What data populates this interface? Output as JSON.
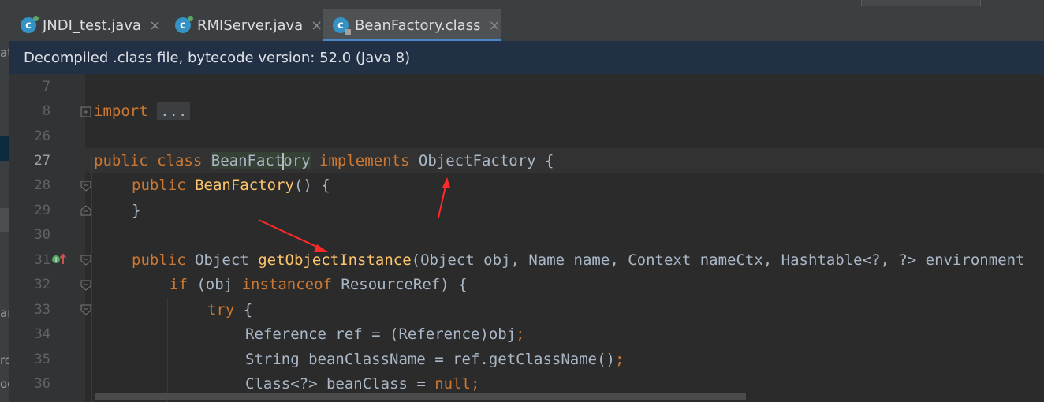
{
  "tabs": [
    {
      "label": "JNDI_test.java",
      "icon": "class-icon",
      "active": false
    },
    {
      "label": "RMIServer.java",
      "icon": "class-icon",
      "active": false
    },
    {
      "label": "BeanFactory.class",
      "icon": "class-icon",
      "active": true
    }
  ],
  "tab_close_glyph": "×",
  "banner_text": "Decompiled .class file, bytecode version: 52.0 (Java 8)",
  "lines": [
    {
      "no": "7"
    },
    {
      "no": "8"
    },
    {
      "no": "26"
    },
    {
      "no": "27"
    },
    {
      "no": "28"
    },
    {
      "no": "29"
    },
    {
      "no": "30"
    },
    {
      "no": "31"
    },
    {
      "no": "32"
    },
    {
      "no": "33"
    },
    {
      "no": "34"
    },
    {
      "no": "35"
    },
    {
      "no": "36"
    }
  ],
  "code": {
    "l8_kw": "import",
    "l8_fold": "...",
    "l27_public": "public",
    "l27_class": "class",
    "l27_name_a": "BeanFact",
    "l27_name_b": "ory",
    "l27_implements": "implements",
    "l27_iface": "ObjectFactory {",
    "l28_public": "public",
    "l28_ctor": "BeanFactory",
    "l28_rest": "() {",
    "l29": "}",
    "l31_public": "public",
    "l31_type": "Object",
    "l31_method": "getObjectInstance",
    "l31_params": "(Object obj, Name name, Context nameCtx, Hashtable<?, ?> environment",
    "l32_if": "if",
    "l32_a": "(obj",
    "l32_instanceof": "instanceof",
    "l32_b": "ResourceRef) {",
    "l33_try": "try",
    "l33_b": "{",
    "l34_a": "Reference ref = (Reference)obj",
    "l34_semi": ";",
    "l35_a": "String beanClassName = ref.getClassName()",
    "l35_semi": ";",
    "l36_a": "Class<?> beanClass =",
    "l36_null": "null",
    "l36_semi": ";"
  },
  "sidebar_fragments": [
    "ate",
    "ar",
    "ro",
    "oc"
  ],
  "colors": {
    "keyword": "#cc7832",
    "method": "#ffc66d",
    "text": "#a9b7c6",
    "annotation_arrow": "#ff2a2a"
  }
}
